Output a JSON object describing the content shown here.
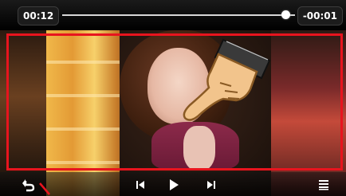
{
  "player": {
    "elapsed_time": "00:12",
    "remaining_time": "-00:01",
    "progress_fraction": 0.96
  },
  "controls": {
    "back_icon": "back-arrow-icon",
    "previous_icon": "skip-previous-icon",
    "play_icon": "play-icon",
    "next_icon": "skip-next-icon",
    "menu_icon": "menu-icon"
  },
  "colors": {
    "highlight": "#e8141e",
    "pointer_fill": "#f2c48c",
    "pointer_stroke": "#8a5a24"
  }
}
